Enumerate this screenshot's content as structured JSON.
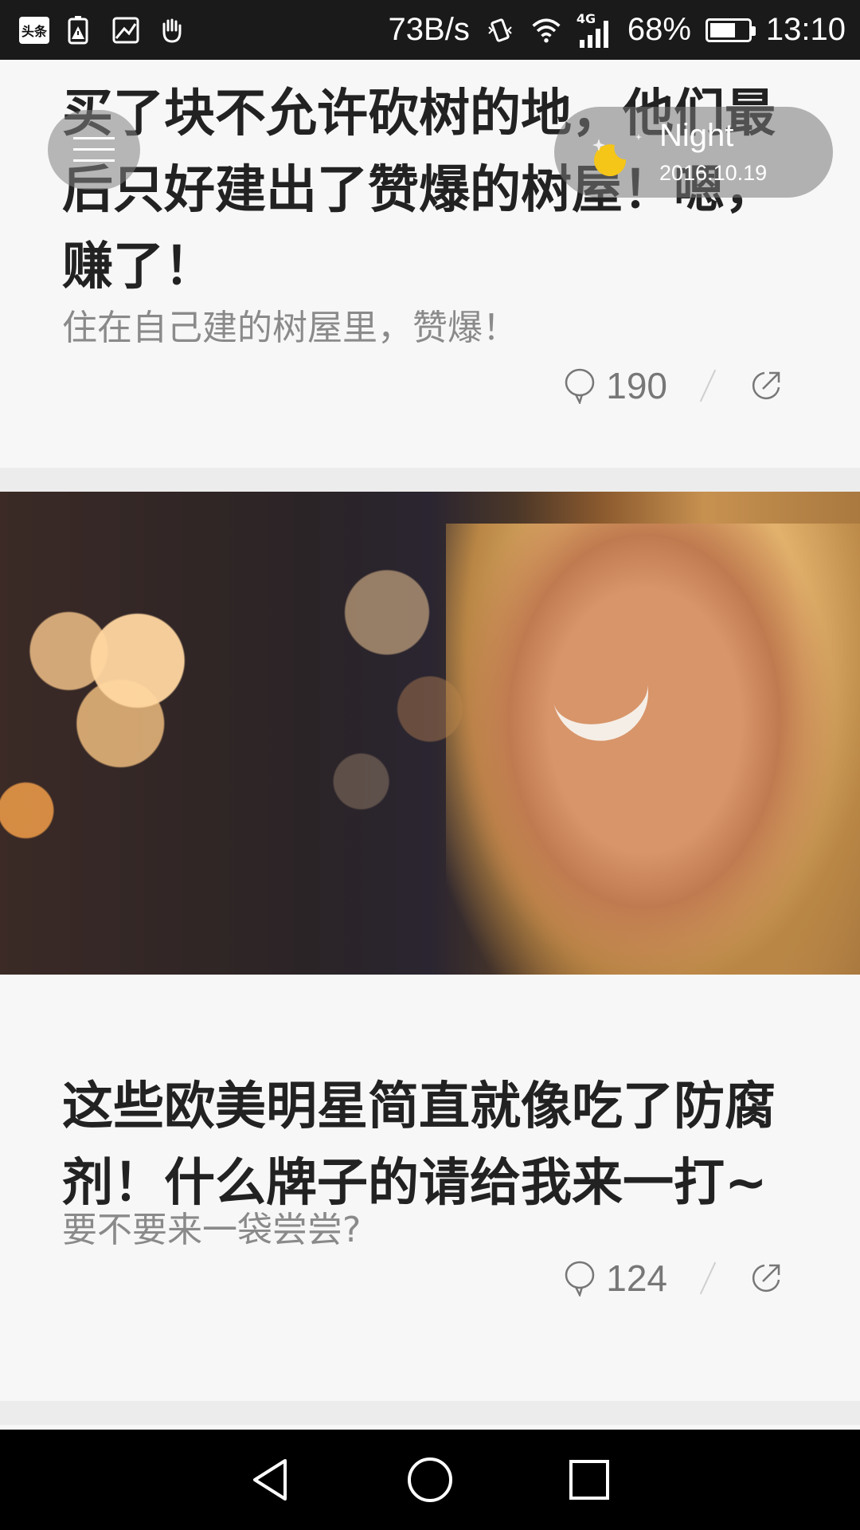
{
  "status_bar": {
    "net_speed": "73B/s",
    "network_type": "4G",
    "battery_percent": "68%",
    "battery_level": 0.68,
    "time": "13:10",
    "app_badge": "头条"
  },
  "overlay": {
    "night_label": "Night",
    "date": "2016.10.19"
  },
  "articles": [
    {
      "title": "买了块不允许砍树的地，他们最后只好建出了赞爆的树屋！嗯，赚了！",
      "subtitle": "住在自己建的树屋里，赞爆！",
      "comments": "190"
    },
    {
      "title": "这些欧美明星简直就像吃了防腐剂！什么牌子的请给我来一打~",
      "subtitle": "要不要来一袋尝尝?",
      "comments": "124"
    }
  ],
  "icons": {
    "comment": "speech-bubble-icon",
    "share": "share-arrow-icon",
    "menu": "hamburger-menu-icon",
    "night": "moon-icon"
  }
}
